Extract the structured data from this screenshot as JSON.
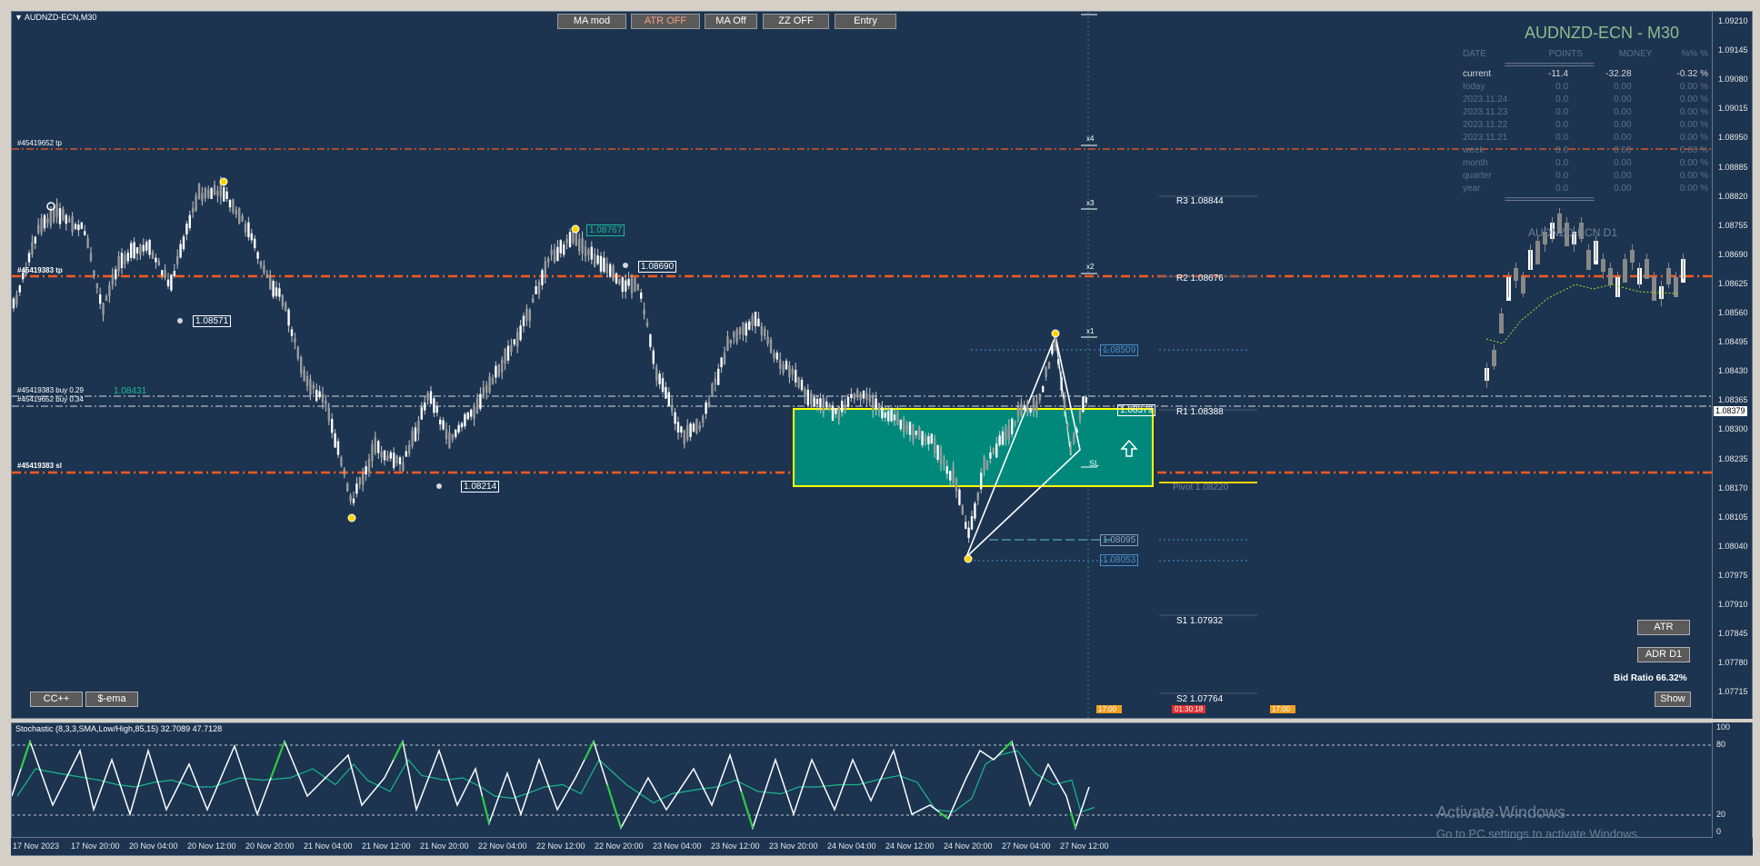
{
  "window": {
    "title": "AUDNZD-ECN,M30"
  },
  "toolbar": {
    "ma_mod": "MA mod",
    "atr": "ATR OFF",
    "ma_off": "MA Off",
    "zz": "ZZ OFF",
    "entry": "Entry"
  },
  "symbol_header": "AUDNZD-ECN - M30",
  "stats": {
    "headers": [
      "DATE",
      "POINTS",
      "MONEY",
      "%%",
      "%"
    ],
    "rows": [
      {
        "label": "current",
        "points": "-11.4",
        "money": "-32.28",
        "pct": "-0.32 %"
      },
      {
        "label": "today",
        "points": "0.0",
        "money": "0.00",
        "pct": "0.00 %"
      },
      {
        "label": "2023.11.24",
        "points": "0.0",
        "money": "0.00",
        "pct": "0.00 %"
      },
      {
        "label": "2023.11.23",
        "points": "0.0",
        "money": "0.00",
        "pct": "0.00 %"
      },
      {
        "label": "2023.11.22",
        "points": "0.0",
        "money": "0.00",
        "pct": "0.00 %"
      },
      {
        "label": "2023.11.21",
        "points": "0.0",
        "money": "0.00",
        "pct": "0.00 %"
      },
      {
        "label": "week",
        "points": "0.0",
        "money": "0.00",
        "pct": "0.00 %"
      },
      {
        "label": "month",
        "points": "0.0",
        "money": "0.00",
        "pct": "0.00 %"
      },
      {
        "label": "quarter",
        "points": "0.0",
        "money": "0.00",
        "pct": "0.00 %"
      },
      {
        "label": "year",
        "points": "0.0",
        "money": "0.00",
        "pct": "0.00 %"
      }
    ],
    "separator": "======================="
  },
  "d1_title": "AUDNZD-ECN D1",
  "trade_labels": {
    "tp": "#45419652 tp",
    "tp2": "#45419383 tp",
    "buy1": "#45419383 buy 0.29",
    "buy2": "#45419652 buy 0.34",
    "sl": "#45419383 sl"
  },
  "pivots": {
    "r3": "R3 1.08844",
    "r2": "R2 1.08676",
    "r1": "R1 1.08388",
    "pivot": "Pivot 1.08220",
    "s1": "S1 1.07932",
    "s2": "S2 1.07764"
  },
  "price_tags": {
    "p08571": "1.08571",
    "p08767": "1.08767",
    "p08690": "1.08690",
    "p08214": "1.08214",
    "p08431": "1.08431",
    "p08509": "1.08509",
    "p08379": "1.08379",
    "p08095": "1.08095",
    "p08053": "1.08053"
  },
  "multipliers": [
    "x4",
    "x3",
    "x2",
    "x1"
  ],
  "sl_marker": "SL",
  "time_badges": [
    "17:00",
    "01:30:18",
    "17:00"
  ],
  "side_buttons": {
    "atr": "ATR",
    "adr": "ADR D1",
    "show": "Show",
    "cc": "CC++",
    "ema": "$-ema"
  },
  "bid_ratio": "Bid Ratio 66.32%",
  "stochastic_label": "Stochastic (8,3,3,SMA,Low/High,85,15) 32.7089 47.7128",
  "price_axis": [
    "1.09210",
    "1.09145",
    "1.09080",
    "1.09015",
    "1.08950",
    "1.08885",
    "1.08820",
    "1.08755",
    "1.08690",
    "1.08625",
    "1.08560",
    "1.08495",
    "1.08430",
    "1.08365",
    "1.08300",
    "1.08235",
    "1.08170",
    "1.08105",
    "1.08040",
    "1.07975",
    "1.07910",
    "1.07845",
    "1.07780",
    "1.07715"
  ],
  "current_price": "1.08379",
  "osc_axis": [
    "100",
    "80",
    "20",
    "0"
  ],
  "time_axis": [
    "17 Nov 2023",
    "17 Nov 20:00",
    "20 Nov 04:00",
    "20 Nov 12:00",
    "20 Nov 20:00",
    "21 Nov 04:00",
    "21 Nov 12:00",
    "21 Nov 20:00",
    "22 Nov 04:00",
    "22 Nov 12:00",
    "22 Nov 20:00",
    "23 Nov 04:00",
    "23 Nov 12:00",
    "23 Nov 20:00",
    "24 Nov 04:00",
    "24 Nov 12:00",
    "24 Nov 20:00",
    "27 Nov 04:00",
    "27 Nov 12:00"
  ],
  "watermark": {
    "line1": "Activate Windows",
    "line2": "Go to PC settings to activate Windows."
  },
  "colors": {
    "background": "#1c3450",
    "trade_line": "#ff5a1e",
    "zone": "#00897b",
    "zone_border": "#ffff00",
    "stoch_main": "#ffffff",
    "stoch_signal": "#1ab88a",
    "stoch_extreme": "#2ecc40"
  }
}
